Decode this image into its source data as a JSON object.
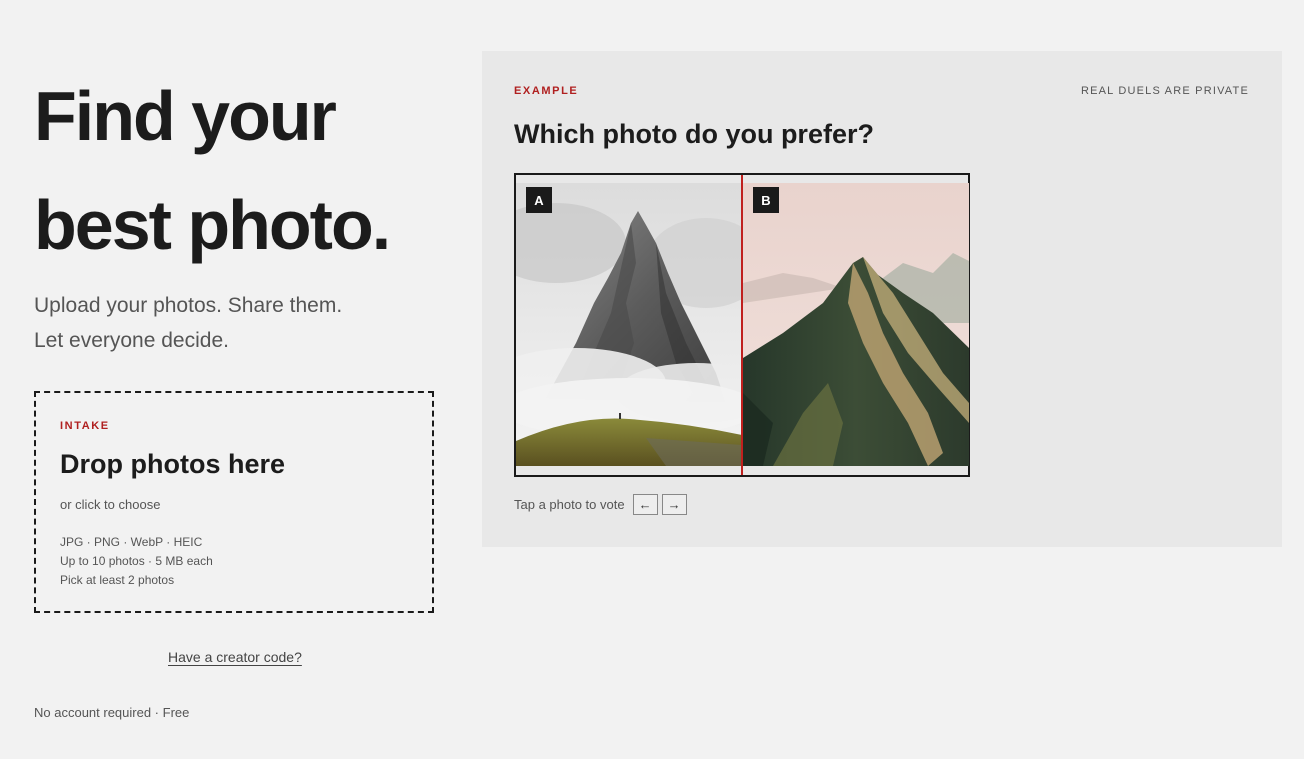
{
  "hero": {
    "title_line1": "Find your",
    "title_line2": "best photo.",
    "subtitle_line1": "Upload your photos. Share them.",
    "subtitle_line2": "Let everyone decide."
  },
  "intake": {
    "tag": "INTAKE",
    "title": "Drop photos here",
    "subtitle": "or click to choose",
    "formats": "JPG · PNG · WebP · HEIC",
    "limits": "Up to 10 photos · 5 MB each",
    "minimum": "Pick at least 2 photos"
  },
  "creator_link": "Have a creator code?",
  "footnote": "No account required · Free",
  "example": {
    "tag": "EXAMPLE",
    "privacy_note": "REAL DUELS ARE PRIVATE",
    "question": "Which photo do you prefer?",
    "photo_a_label": "A",
    "photo_b_label": "B",
    "vote_hint": "Tap a photo to vote",
    "prev_label": "←",
    "next_label": "→"
  },
  "colors": {
    "accent_red": "#b02020",
    "background": "#f2f2f2",
    "panel": "#e8e8e8",
    "ink": "#1a1a1a"
  },
  "icons": {
    "prev": "arrow-left-icon",
    "next": "arrow-right-icon"
  }
}
